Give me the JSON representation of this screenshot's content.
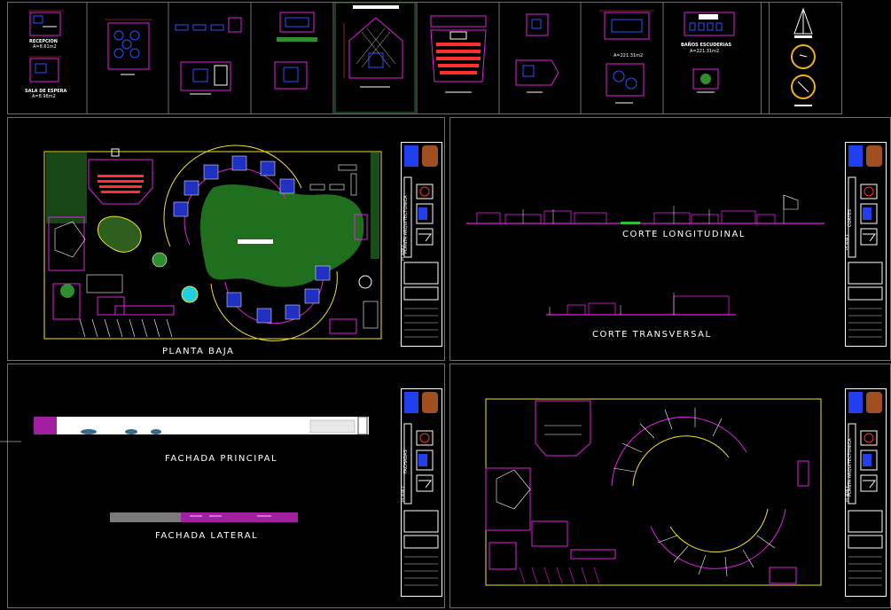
{
  "colors": {
    "background": "#000000",
    "frame": "#6f6f6f",
    "magenta": "#e020e0",
    "yellow": "#f0e030",
    "red": "#ff3030",
    "blue": "#3050ff",
    "green": "#30c030",
    "white": "#ffffff",
    "cyan": "#20d0e0"
  },
  "thumbnails": {
    "recepcion_label": "RECEPCION",
    "recepcion_area": "A=8.61m2",
    "sala_espera_label": "SALA DE ESPERA",
    "sala_espera_area": "A=8.98m2",
    "area_a": "A=221.31m2",
    "banos_label": "BAÑOS ESCUDERIAS",
    "banos_area": "A=221.31m2"
  },
  "sheets": {
    "planta": {
      "caption": "PLANTA BAJA",
      "block_title": "PLANTA ARQUITECTONICA",
      "block_label": "PLANO:"
    },
    "cortes": {
      "caption_long": "CORTE LONGITUDINAL",
      "caption_trans": "CORTE TRANSVERSAL",
      "block_title": "CORTES",
      "block_label": "PLANO:"
    },
    "fachadas": {
      "caption_principal": "FACHADA PRINCIPAL",
      "caption_lateral": "FACHADA LATERAL",
      "block_title": "FACHADAS",
      "block_label": "PLANO:"
    },
    "estructura": {
      "block_title": "PLANTA ARQUITECTONICA",
      "block_label": "PLANO:"
    }
  }
}
